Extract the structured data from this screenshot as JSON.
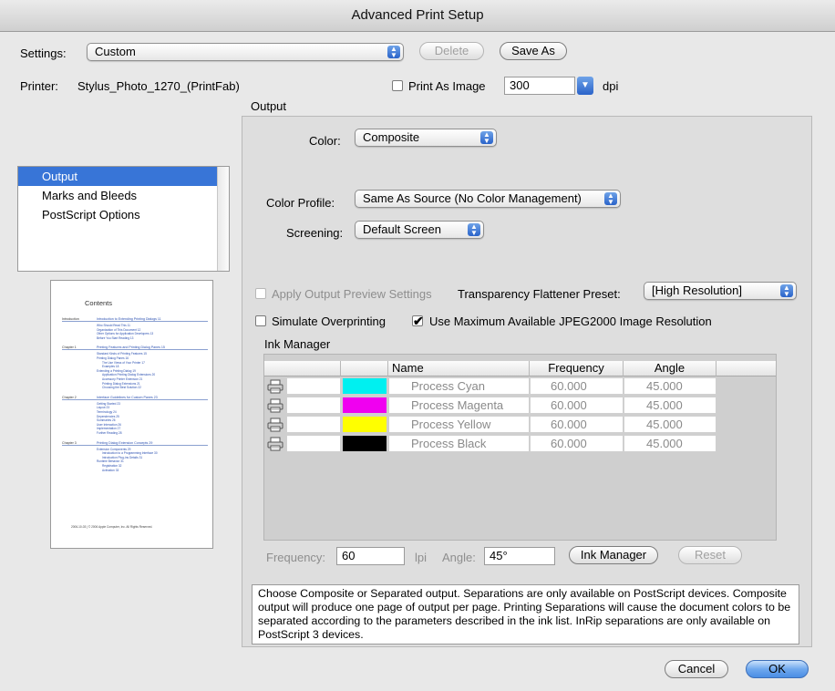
{
  "window": {
    "title": "Advanced Print Setup"
  },
  "settings": {
    "label": "Settings:",
    "value": "Custom",
    "delete_label": "Delete",
    "save_as_label": "Save As"
  },
  "printer": {
    "label": "Printer:",
    "name": "Stylus_Photo_1270_(PrintFab)",
    "print_as_image_label": "Print As Image",
    "dpi_value": "300",
    "dpi_unit": "dpi"
  },
  "sidebar": {
    "items": [
      {
        "label": "Output",
        "selected": true
      },
      {
        "label": "Marks and Bleeds"
      },
      {
        "label": "PostScript Options"
      }
    ]
  },
  "preview": {
    "title": "Contents",
    "toc": [
      {
        "kind": "chapter",
        "num": "Introduction",
        "text": "Introduction to Extending Printing Dialogs  11"
      },
      {
        "kind": "line",
        "text": "Who Should Read This  11"
      },
      {
        "kind": "line",
        "text": "Organization of This Document  12"
      },
      {
        "kind": "line",
        "text": "Other Options for Application Developers  13"
      },
      {
        "kind": "line",
        "text": "Before You Start Reading  13"
      },
      {
        "kind": "chapter",
        "num": "Chapter 1",
        "text": "Printing Features and Printing Dialog Panes  15"
      },
      {
        "kind": "line",
        "text": "Standard Kinds of Printing Features  15"
      },
      {
        "kind": "line",
        "text": "Printing Dialog Panes  16"
      },
      {
        "kind": "sub",
        "text": "The Use Views of Your Printer  17"
      },
      {
        "kind": "sub",
        "text": "Examples  18"
      },
      {
        "kind": "line",
        "text": "Extending a Printing Dialog  19"
      },
      {
        "kind": "sub",
        "text": "Application Printing Dialog Extensions  20"
      },
      {
        "kind": "sub",
        "text": "Accessory Printer Extension  21"
      },
      {
        "kind": "sub",
        "text": "Printing Dialog Extensions  21"
      },
      {
        "kind": "sub",
        "text": "Choosing the Best Solution  22"
      },
      {
        "kind": "chapter",
        "num": "Chapter 2",
        "text": "Interface Guidelines for Custom Panes  23"
      },
      {
        "kind": "line",
        "text": "Getting Started  23"
      },
      {
        "kind": "line",
        "text": "Layout  23"
      },
      {
        "kind": "line",
        "text": "Terminology  24"
      },
      {
        "kind": "line",
        "text": "Dependencies  25"
      },
      {
        "kind": "line",
        "text": "Summaries  26"
      },
      {
        "kind": "line",
        "text": "User Interaction  26"
      },
      {
        "kind": "line",
        "text": "Implementation  27"
      },
      {
        "kind": "line",
        "text": "Further Reading  28"
      },
      {
        "kind": "chapter",
        "num": "Chapter 3",
        "text": "Printing Dialog Extension Concepts  29"
      },
      {
        "kind": "line",
        "text": "Extension Components  29"
      },
      {
        "kind": "sub",
        "text": "Introduction to a Programming Interface  30"
      },
      {
        "kind": "sub",
        "text": "Introduction Plug-ins Details  31"
      },
      {
        "kind": "line",
        "text": "Runtime Behavior  31"
      },
      {
        "kind": "sub",
        "text": "Registration  32"
      },
      {
        "kind": "sub",
        "text": "Activation  33"
      }
    ],
    "footer": "2006-10-03   |   © 2006 Apple Computer, Inc. All Rights Reserved."
  },
  "output": {
    "section_title": "Output",
    "color_label": "Color:",
    "color_value": "Composite",
    "color_profile_label": "Color Profile:",
    "color_profile_value": "Same As Source (No Color Management)",
    "screening_label": "Screening:",
    "screening_value": "Default Screen",
    "apply_preview_label": "Apply Output Preview Settings",
    "flattener_label": "Transparency Flattener Preset:",
    "flattener_value": "[High Resolution]",
    "simulate_overprint_label": "Simulate Overprinting",
    "max_jpeg_label": "Use Maximum Available JPEG2000 Image Resolution"
  },
  "ink_manager": {
    "title": "Ink Manager",
    "headers": {
      "name": "Name",
      "frequency": "Frequency",
      "angle": "Angle"
    },
    "rows": [
      {
        "name": "Process Cyan",
        "frequency": "60.000",
        "angle": "45.000",
        "color": "#00f0f0"
      },
      {
        "name": "Process Magenta",
        "frequency": "60.000",
        "angle": "45.000",
        "color": "#f000f0"
      },
      {
        "name": "Process Yellow",
        "frequency": "60.000",
        "angle": "45.000",
        "color": "#ffff00"
      },
      {
        "name": "Process Black",
        "frequency": "60.000",
        "angle": "45.000",
        "color": "#000000"
      }
    ],
    "frequency_label": "Frequency:",
    "frequency_value": "60",
    "lpi": "lpi",
    "angle_label": "Angle:",
    "angle_value": "45°",
    "ink_manager_button": "Ink Manager",
    "reset_button": "Reset"
  },
  "description": "Choose Composite or Separated output. Separations are only available on PostScript devices. Composite output will produce one page of output per page. Printing Separations will cause the document colors to be separated according to the parameters described in the ink list. InRip separations are only available on PostScript 3 devices.",
  "footer": {
    "cancel_label": "Cancel",
    "ok_label": "OK"
  }
}
